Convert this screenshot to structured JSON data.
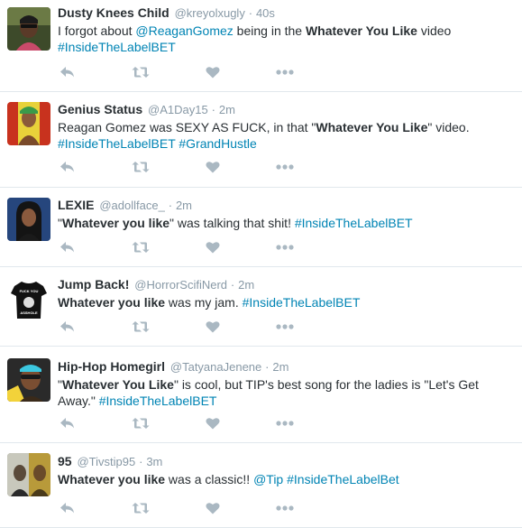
{
  "colors": {
    "link": "#0084b4",
    "meta": "#8899a6",
    "text": "#292f33",
    "icon": "#aab8c2",
    "divider": "#e1e8ed"
  },
  "tweets": [
    {
      "fullname": "Dusty Knees Child",
      "username": "@kreyolxugly",
      "separator": "·",
      "time": "40s",
      "text": {
        "t1": "I forgot about ",
        "mention1": "@ReaganGomez",
        "t2": " being in the ",
        "bold1": "Whatever You Like",
        "t3": " video",
        "hashtag1": "#InsideTheLabelBET"
      }
    },
    {
      "fullname": "Genius Status",
      "username": "@A1Day15",
      "separator": "·",
      "time": "2m",
      "text": {
        "t1": "Reagan Gomez was SEXY AS FUCK, in that \"",
        "bold1": "Whatever You Like",
        "t2": "\" video.",
        "hashtag1": "#InsideTheLabelBET",
        "hashtag2": "#GrandHustle"
      }
    },
    {
      "fullname": "LEXIE",
      "username": "@adollface_",
      "separator": "·",
      "time": "2m",
      "text": {
        "t1": "\"",
        "bold1": "Whatever you like",
        "t2": "\" was talking that shit! ",
        "hashtag1": "#InsideTheLabelBET"
      }
    },
    {
      "fullname": "Jump Back!",
      "username": "@HorrorScifiNerd",
      "separator": "·",
      "time": "2m",
      "text": {
        "bold1": "Whatever you like",
        "t1": " was my jam. ",
        "hashtag1": "#InsideTheLabelBET"
      }
    },
    {
      "fullname": "Hip-Hop Homegirl",
      "username": "@TatyanaJenene",
      "separator": "·",
      "time": "2m",
      "text": {
        "t1": "\"",
        "bold1": "Whatever You Like",
        "t2": "\" is cool, but TIP's best song for the ladies is \"Let's Get Away.\" ",
        "hashtag1": "#InsideTheLabelBET"
      }
    },
    {
      "fullname": "95",
      "username": "@Tivstip95",
      "separator": "·",
      "time": "3m",
      "text": {
        "bold1": "Whatever you like",
        "t1": " was a classic!! ",
        "mention1": "@Tip",
        "hashtag1": "#InsideTheLabelBet"
      }
    }
  ],
  "icons": {
    "reply": "reply-icon",
    "retweet": "retweet-icon",
    "like": "heart-icon",
    "more": "more-icon"
  },
  "avatars": {
    "0": {
      "text1": "",
      "text2": ""
    },
    "3": {
      "shirt_text1": "FUCK YOU",
      "shirt_text2": "ASSHOLE"
    }
  }
}
